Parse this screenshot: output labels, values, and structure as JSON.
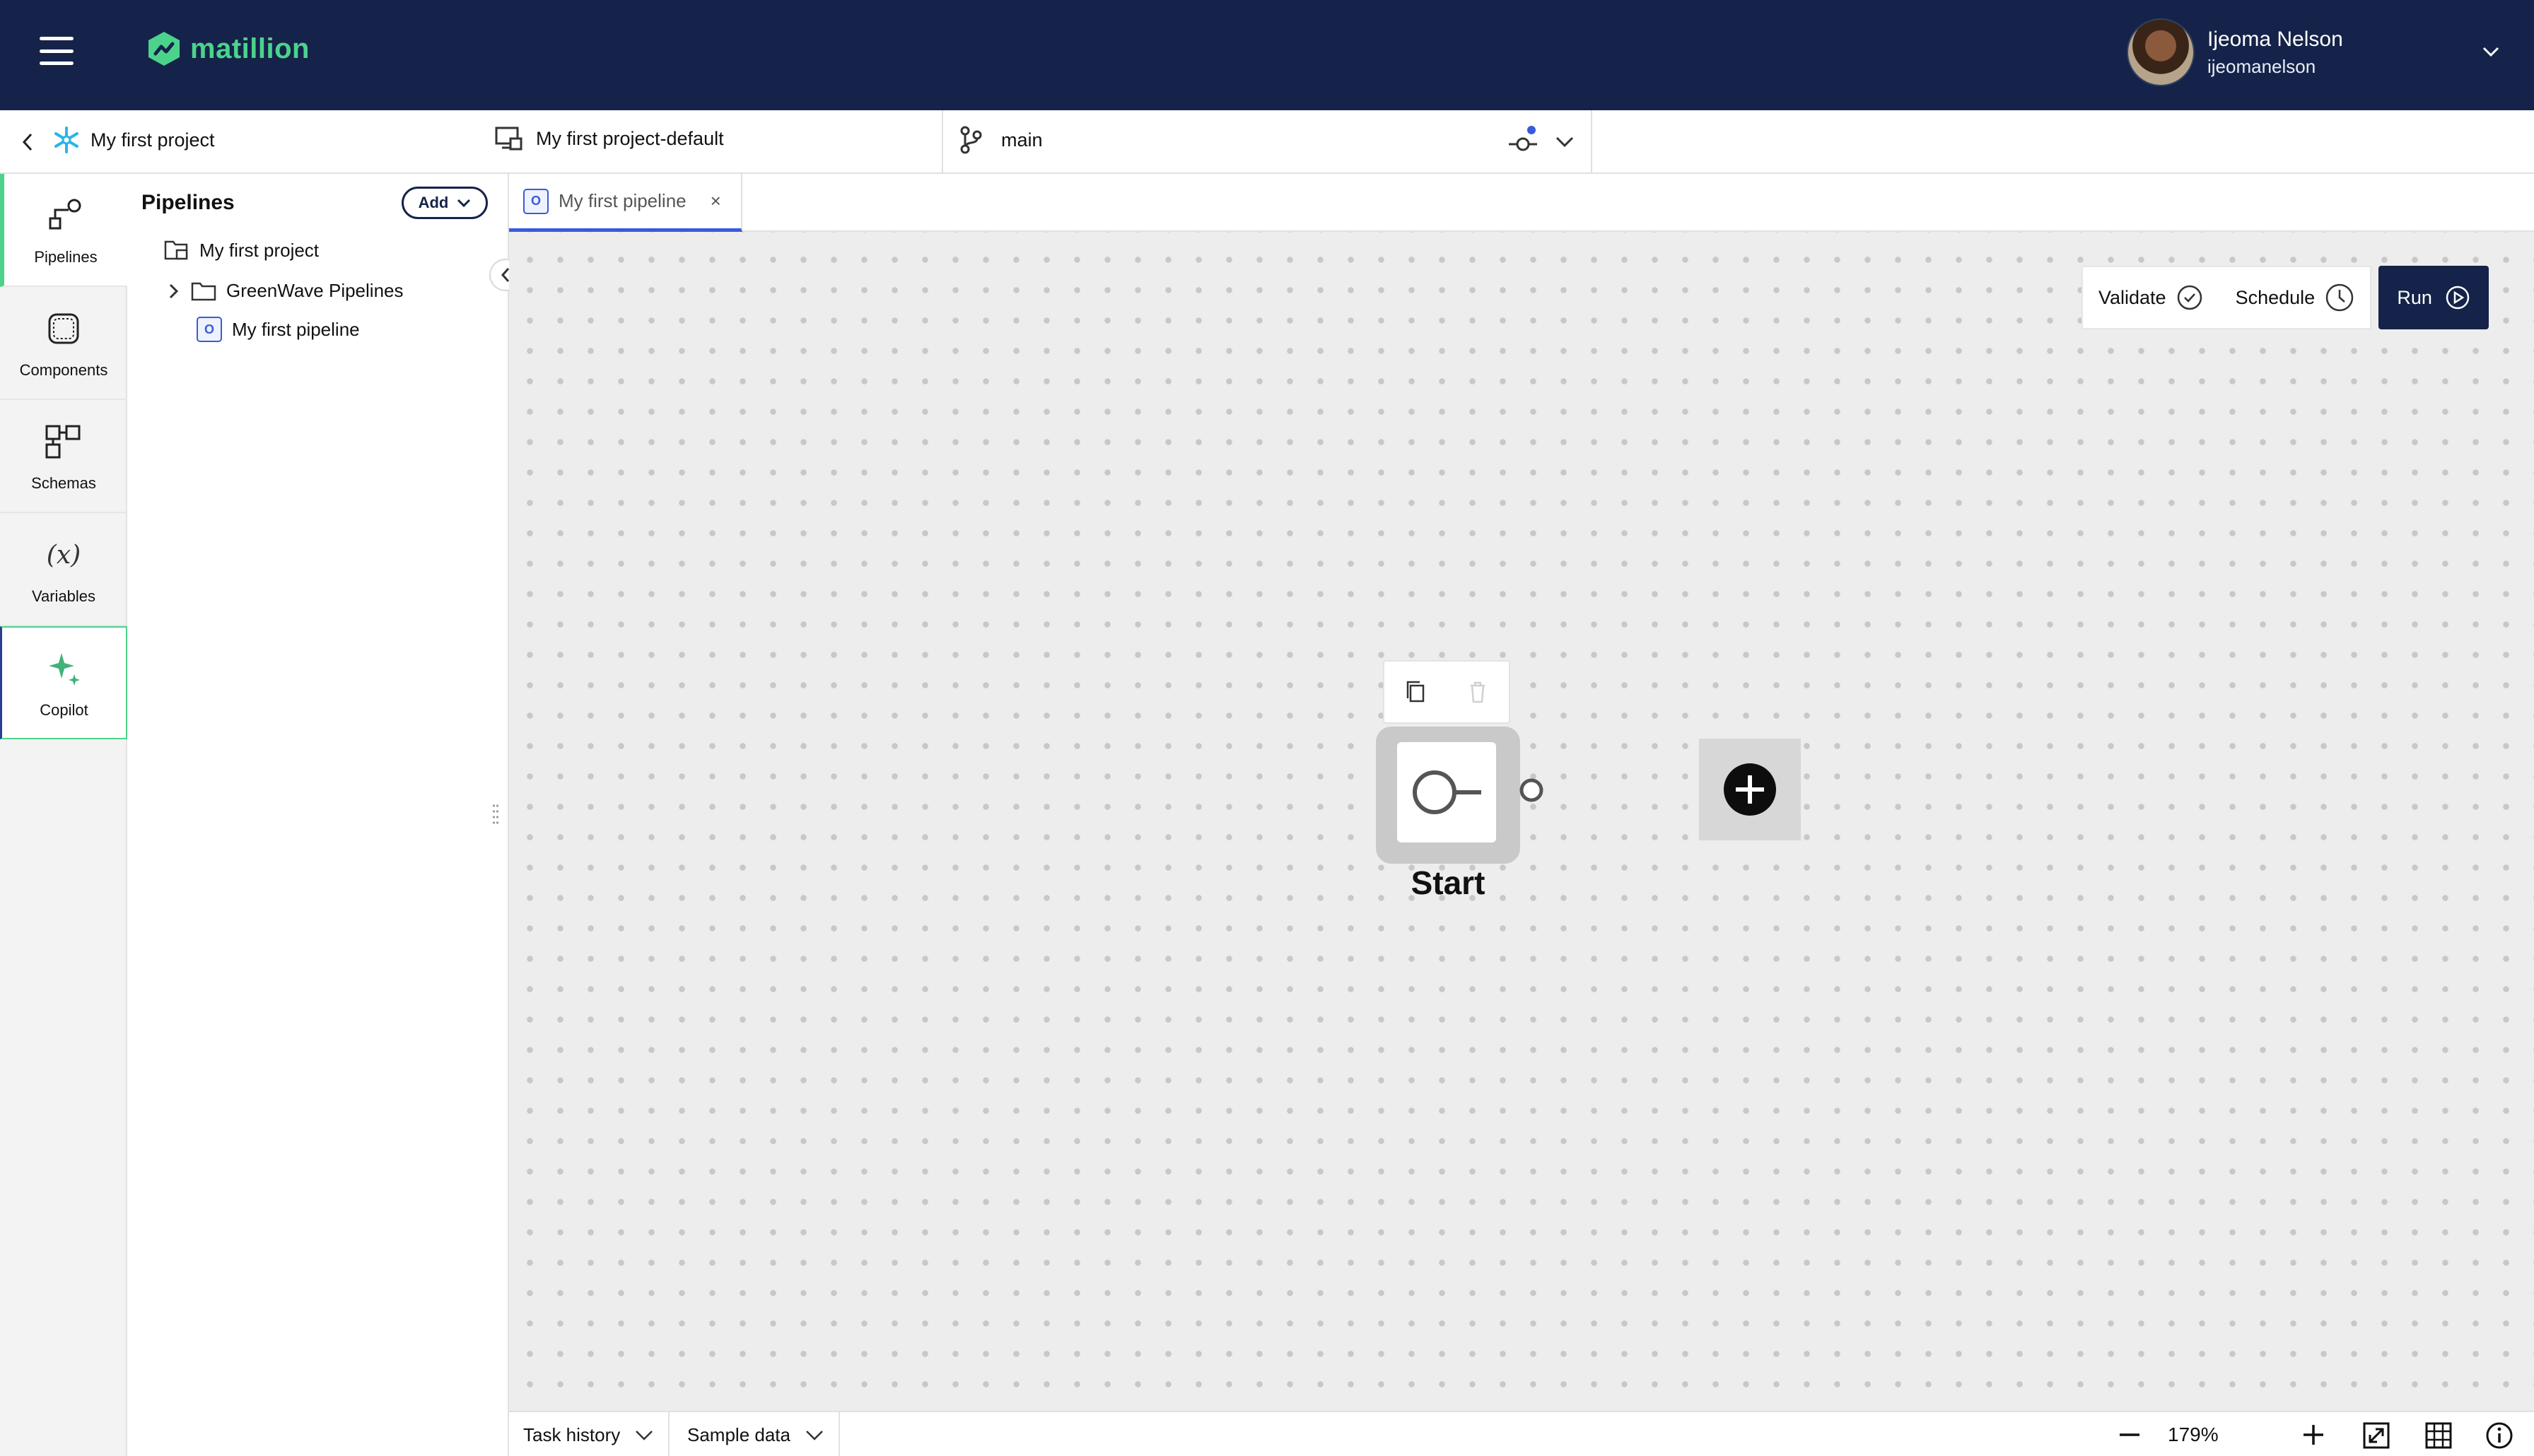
{
  "header": {
    "brand": "matillion",
    "user_name": "Ijeoma Nelson",
    "user_handle": "ijeomanelson"
  },
  "context": {
    "project": "My first project",
    "environment": "My first project-default",
    "branch": "main"
  },
  "rail": {
    "items": [
      {
        "label": "Pipelines",
        "icon": "pipelines-icon"
      },
      {
        "label": "Components",
        "icon": "components-icon"
      },
      {
        "label": "Schemas",
        "icon": "schemas-icon"
      },
      {
        "label": "Variables",
        "icon": "variables-icon"
      },
      {
        "label": "Copilot",
        "icon": "sparkle-icon"
      }
    ],
    "variables_glyph": "(x)"
  },
  "panel": {
    "title": "Pipelines",
    "add_label": "Add",
    "tree": [
      {
        "label": "My first project",
        "type": "project"
      },
      {
        "label": "GreenWave Pipelines",
        "type": "folder"
      },
      {
        "label": "My first pipeline",
        "type": "pipeline",
        "badge": "O"
      }
    ]
  },
  "tabs": [
    {
      "label": "My first pipeline",
      "badge": "O",
      "close": "×"
    }
  ],
  "canvas": {
    "validate_label": "Validate",
    "schedule_label": "Schedule",
    "run_label": "Run",
    "node_label": "Start"
  },
  "bottom": {
    "task_history_label": "Task history",
    "sample_data_label": "Sample data",
    "zoom_level": "179%"
  },
  "colors": {
    "header_bg": "#15234a",
    "brand_green": "#4bd38b",
    "accent_blue": "#3a5bd9"
  }
}
